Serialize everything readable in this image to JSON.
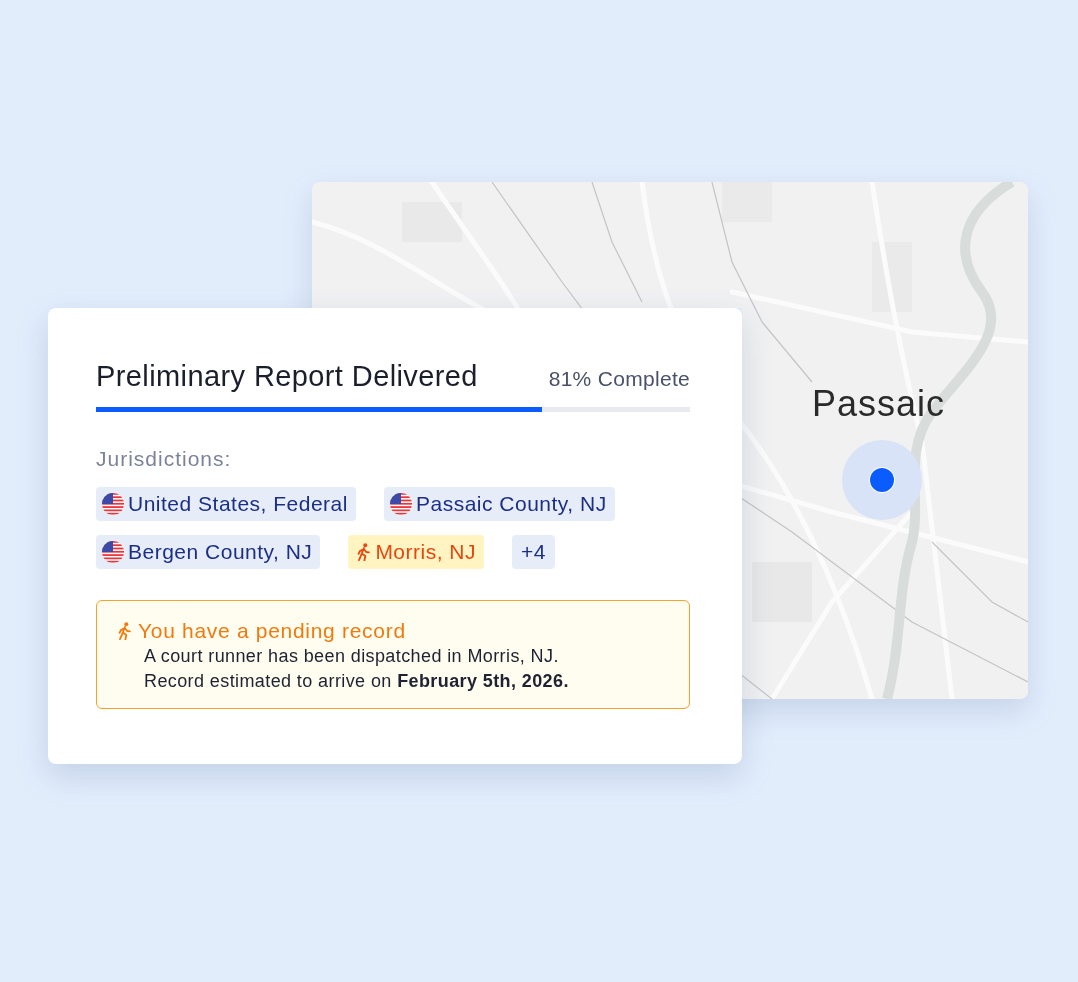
{
  "map": {
    "label": "Passaic"
  },
  "report": {
    "title": "Preliminary Report Delivered",
    "progress_text": "81% Complete",
    "progress": {
      "level": 0.75
    }
  },
  "jurisdictions": {
    "label": "Jurisdictions:",
    "chips": [
      {
        "label": "United States, Federal",
        "kind": "flag"
      },
      {
        "label": "Passaic County, NJ",
        "kind": "flag"
      },
      {
        "label": "Bergen County, NJ",
        "kind": "flag"
      },
      {
        "label": "Morris, NJ",
        "kind": "pending"
      },
      {
        "label": "+4",
        "kind": "more"
      }
    ]
  },
  "alert": {
    "title": "You have a pending record",
    "lines": [
      "A court runner has been dispatched in Morris, NJ.",
      "Record estimated to arrive on **February 5th, 2026.**"
    ]
  }
}
